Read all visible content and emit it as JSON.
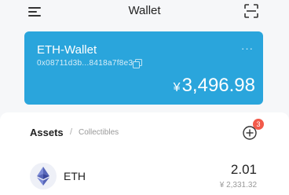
{
  "header": {
    "title": "Wallet"
  },
  "wallet_card": {
    "name": "ETH-Wallet",
    "more": "···",
    "address": "0x08711d3b...8418a7f8e3",
    "currency_symbol": "¥",
    "balance": "3,496.98",
    "background_color": "#2aa5dc"
  },
  "assets_section": {
    "tab_assets": "Assets",
    "separator": "/",
    "tab_collectibles": "Collectibles",
    "add_badge_count": "3",
    "badge_color": "#f25a4a"
  },
  "asset_list": [
    {
      "symbol": "ETH",
      "amount": "2.01",
      "value": "¥ 2,331.32",
      "icon": "ethereum-icon"
    }
  ]
}
